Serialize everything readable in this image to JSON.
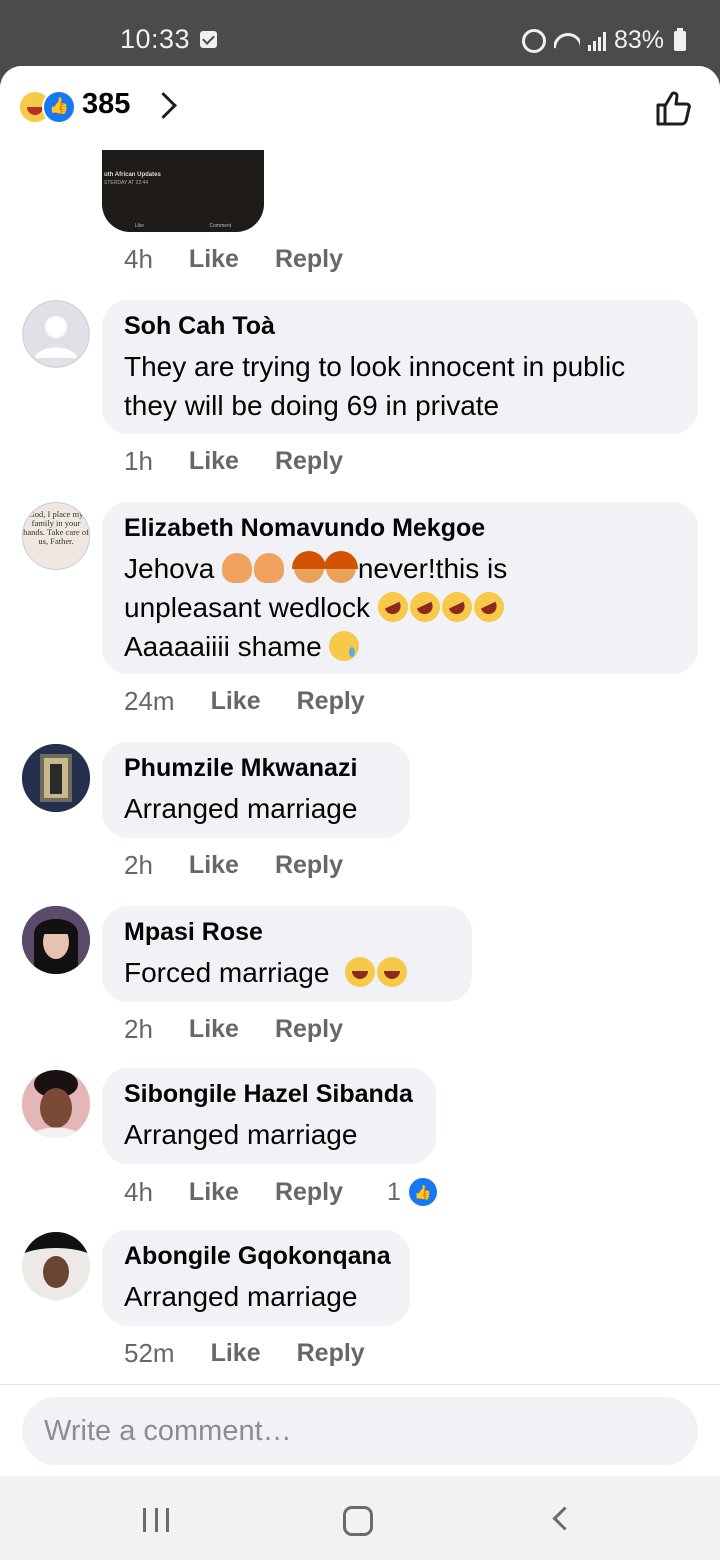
{
  "status_bar": {
    "time": "10:33",
    "battery": "83%"
  },
  "header": {
    "reaction_count": "385"
  },
  "first_comment": {
    "media_title": "uth African Updates",
    "media_subtitle": "STERDAY AT 22:44",
    "media_actions": [
      "Like",
      "Comment"
    ],
    "time": "4h",
    "like": "Like",
    "reply": "Reply"
  },
  "comments": [
    {
      "name": "Soh Cah Toà",
      "text": "They are trying to look innocent in public they will be doing 69 in private",
      "time": "1h",
      "like": "Like",
      "reply": "Reply"
    },
    {
      "name": "Elizabeth Nomavundo Mekgoe",
      "text_1": "Jehova",
      "text_2": "never!this is",
      "text_3": "unpleasant wedlock",
      "text_4": "Aaaaaiiii shame",
      "time": "24m",
      "like": "Like",
      "reply": "Reply",
      "avatar_text": "God, I place my family in your hands. Take care of us, Father."
    },
    {
      "name": "Phumzile Mkwanazi",
      "text": "Arranged marriage",
      "time": "2h",
      "like": "Like",
      "reply": "Reply"
    },
    {
      "name": "Mpasi Rose",
      "text": "Forced marriage",
      "time": "2h",
      "like": "Like",
      "reply": "Reply"
    },
    {
      "name": "Sibongile Hazel Sibanda",
      "text": "Arranged marriage",
      "time": "4h",
      "like": "Like",
      "reply": "Reply",
      "reaction_count": "1"
    },
    {
      "name": "Abongile Gqokonqana",
      "text": "Arranged marriage",
      "time": "52m",
      "like": "Like",
      "reply": "Reply"
    }
  ],
  "composer": {
    "placeholder": "Write a comment…"
  },
  "colors": {
    "accent": "#1877f2",
    "bubble": "#f0f2f5",
    "meta": "#65676b"
  }
}
